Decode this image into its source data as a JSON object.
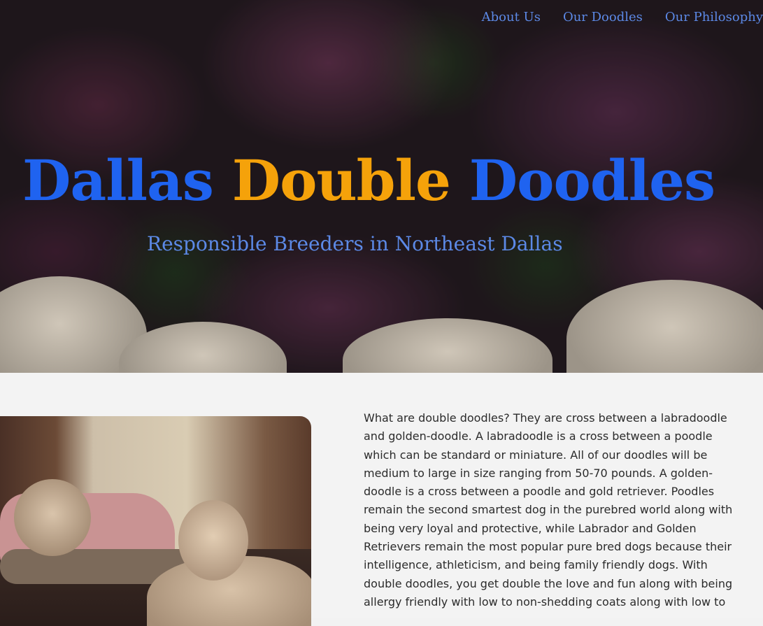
{
  "nav": {
    "items": [
      {
        "label": "About Us"
      },
      {
        "label": "Our Doodles"
      },
      {
        "label": "Our Philosophy"
      }
    ]
  },
  "hero": {
    "title_word1": "Dallas",
    "title_word2": "Double",
    "title_word3": "Doodles",
    "subtitle": "Responsible Breeders in Northeast Dallas"
  },
  "colors": {
    "title_blue": "#1f63f0",
    "title_orange": "#f5a20a",
    "nav_link": "#5c89e6"
  },
  "content": {
    "paragraph": "What are double doodles? They are cross between a labradoodle and golden-doodle. A labradoodle is a cross between a poodle which can be standard or miniature. All of our doodles will be medium to large in size ranging from 50-70 pounds. A golden-doodle is a cross between a poodle and gold retriever. Poodles remain the second smartest dog in the purebred world along with being very loyal and protective, while Labrador and Golden Retrievers remain the most popular pure bred dogs because their intelligence, athleticism, and being family friendly dogs. With double doodles, you get double the love and fun along with being allergy friendly with low to non-shedding coats along with low to"
  }
}
